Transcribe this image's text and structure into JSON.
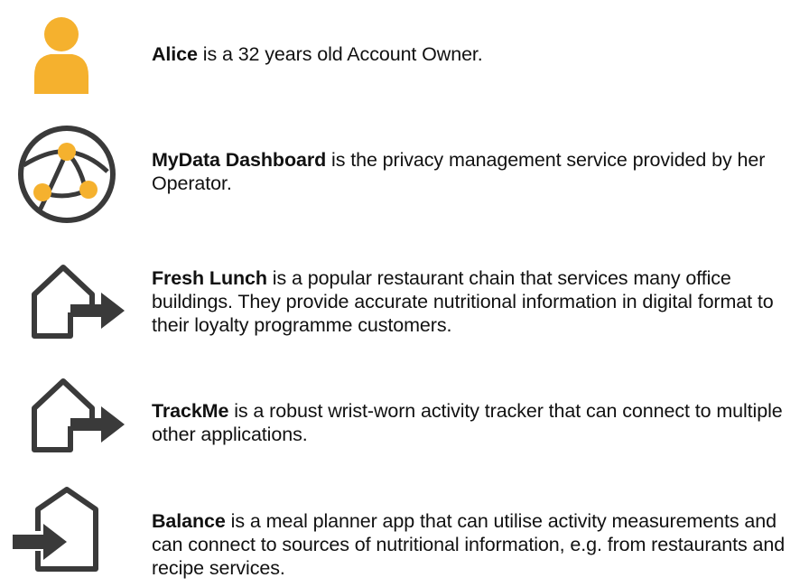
{
  "actors": [
    {
      "id": "alice",
      "name": "Alice",
      "description": " is a 32 years old Account Owner.",
      "icon": "person-icon",
      "icon_color": "#F5B12E"
    },
    {
      "id": "mydata",
      "name": "MyData Dashboard",
      "description": " is the privacy management service provided by her Operator.",
      "icon": "network-globe-icon",
      "icon_color": "#F5B12E"
    },
    {
      "id": "freshlunch",
      "name": "Fresh Lunch",
      "description": " is a popular restaurant chain that services many office buildings. They provide accurate nutritional information in digital format to their loyalty programme customers.",
      "icon": "house-arrow-out-icon"
    },
    {
      "id": "trackme",
      "name": "TrackMe",
      "description": " is a robust wrist-worn activity tracker that can connect to multiple other applications.",
      "icon": "house-arrow-out-icon"
    },
    {
      "id": "balance",
      "name": "Balance",
      "description": " is a meal planner app that can utilise activity measurements and can connect to sources of nutritional information, e.g. from restaurants and recipe services.",
      "icon": "house-arrow-in-icon"
    }
  ],
  "colors": {
    "accent": "#F5B12E",
    "icon_stroke": "#3A3A3A"
  }
}
